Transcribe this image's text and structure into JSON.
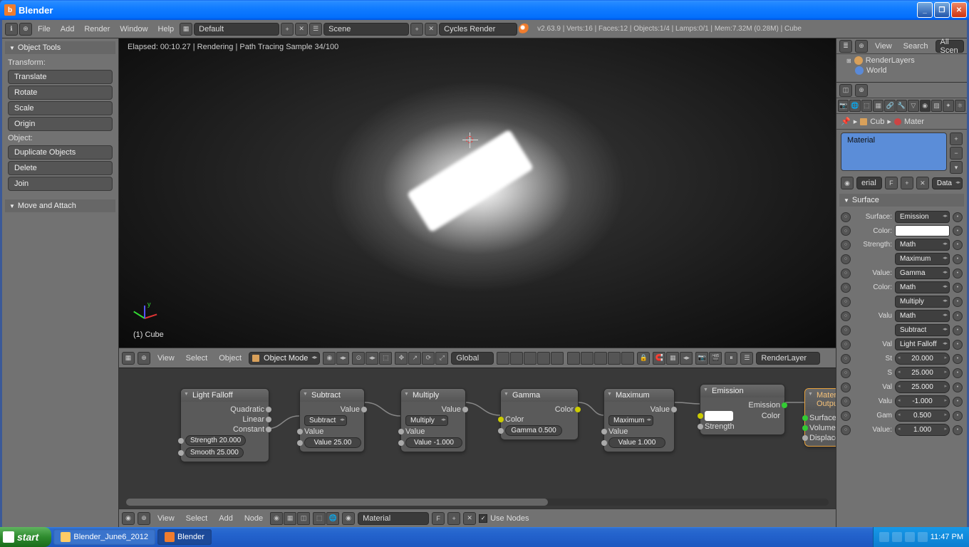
{
  "window": {
    "title": "Blender"
  },
  "info": {
    "menus": [
      "File",
      "Add",
      "Render",
      "Window",
      "Help"
    ],
    "layout": "Default",
    "scene": "Scene",
    "engine": "Cycles Render",
    "stats": "v2.63.9 | Verts:16 | Faces:12 | Objects:1/4 | Lamps:0/1 | Mem:7.32M (0.28M) | Cube"
  },
  "tools": {
    "header": "Object Tools",
    "transform_label": "Transform:",
    "transform": [
      "Translate",
      "Rotate",
      "Scale",
      "Origin"
    ],
    "object_label": "Object:",
    "object": [
      "Duplicate Objects",
      "Delete",
      "Join"
    ],
    "move_header": "Move and Attach"
  },
  "viewport": {
    "status": "Elapsed: 00:10.27 | Rendering | Path Tracing Sample 34/100",
    "object_label": "(1) Cube",
    "mode": "Object Mode",
    "orient": "Global",
    "renderlayer": "RenderLayer",
    "footer_menus": [
      "View",
      "Select",
      "Object"
    ]
  },
  "nodes": {
    "light_falloff": {
      "title": "Light Falloff",
      "outs": [
        "Quadratic",
        "Linear",
        "Constant"
      ],
      "strength": "Strength 20.000",
      "smooth": "Smooth 25.000"
    },
    "subtract": {
      "title": "Subtract",
      "out": "Value",
      "op": "Subtract",
      "in1": "Value",
      "in2": "Value 25.00"
    },
    "multiply": {
      "title": "Multiply",
      "out": "Value",
      "op": "Multiply",
      "in1": "Value",
      "in2": "Value -1.000"
    },
    "gamma": {
      "title": "Gamma",
      "out": "Color",
      "in_color": "Color",
      "gamma": "Gamma 0.500"
    },
    "maximum": {
      "title": "Maximum",
      "out": "Value",
      "op": "Maximum",
      "in1": "Value",
      "in2": "Value 1.000"
    },
    "emission": {
      "title": "Emission",
      "out": "Emission",
      "color": "Color",
      "strength": "Strength"
    },
    "output": {
      "title": "Material Outpu",
      "surface": "Surface",
      "volume": "Volume",
      "disp": "Displacement"
    }
  },
  "node_footer": {
    "menus": [
      "View",
      "Select",
      "Add",
      "Node"
    ],
    "material": "Material",
    "use_nodes": "Use Nodes"
  },
  "outliner": {
    "menus": [
      "View",
      "Search"
    ],
    "filter": "All Scen",
    "items": [
      {
        "name": "RenderLayers",
        "icon": "#d8a05a"
      },
      {
        "name": "World",
        "icon": "#5a8ad8"
      }
    ]
  },
  "props": {
    "crumb_cube": "Cub",
    "crumb_mat": "Mater",
    "material": "Material",
    "data_link": "Data",
    "surface_header": "Surface",
    "rows": [
      {
        "lbl": "Surface:",
        "type": "dd",
        "val": "Emission"
      },
      {
        "lbl": "Color:",
        "type": "swatch"
      },
      {
        "lbl": "Strength:",
        "type": "dd",
        "val": "Math"
      },
      {
        "lbl": "",
        "type": "dd",
        "val": "Maximum"
      },
      {
        "lbl": "Value:",
        "type": "dd",
        "val": "Gamma"
      },
      {
        "lbl": "Color:",
        "type": "dd",
        "val": "Math"
      },
      {
        "lbl": "",
        "type": "dd",
        "val": "Multiply"
      },
      {
        "lbl": "Valu",
        "type": "dd",
        "val": "Math"
      },
      {
        "lbl": "",
        "type": "dd",
        "val": "Subtract"
      },
      {
        "lbl": "Val",
        "type": "dd",
        "val": "Light Falloff"
      },
      {
        "lbl": "St",
        "type": "num",
        "val": "20.000"
      },
      {
        "lbl": "S",
        "type": "num",
        "val": "25.000"
      },
      {
        "lbl": "Val",
        "type": "num",
        "val": "25.000"
      },
      {
        "lbl": "Valu",
        "type": "num",
        "val": "-1.000"
      },
      {
        "lbl": "Gam",
        "type": "num",
        "val": "0.500"
      },
      {
        "lbl": "Value:",
        "type": "num",
        "val": "1.000"
      }
    ],
    "mat_name_short": "erial"
  },
  "taskbar": {
    "start": "start",
    "items": [
      "Blender_June6_2012",
      "Blender"
    ],
    "time": "11:47 PM"
  }
}
